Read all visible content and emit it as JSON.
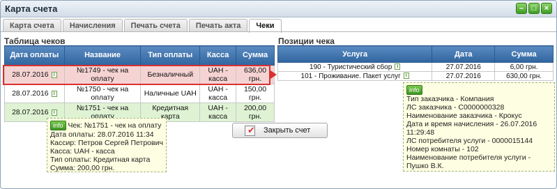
{
  "window": {
    "title": "Карта счета"
  },
  "tabs": [
    {
      "label": "Карта счета"
    },
    {
      "label": "Начисления"
    },
    {
      "label": "Печать счета"
    },
    {
      "label": "Печать акта"
    },
    {
      "label": "Чеки"
    }
  ],
  "checks_table": {
    "title": "Таблица чеков",
    "headers": [
      "Дата оплаты",
      "Название",
      "Тип оплаты",
      "Касса",
      "Сумма"
    ],
    "rows": [
      {
        "date": "28.07.2016",
        "name": "№1749 - чек на оплату",
        "pay_type": "Безналичный",
        "cash_desk": "UAH - касса",
        "sum": "636,00 грн."
      },
      {
        "date": "28.07.2016",
        "name": "№1750 - чек на оплату",
        "pay_type": "Наличные UAH",
        "cash_desk": "UAH - касса",
        "sum": "150,00 грн."
      },
      {
        "date": "28.07.2016",
        "name": "№1751 - чек на оплату",
        "pay_type": "Кредитная карта",
        "cash_desk": "UAH - касса",
        "sum": "200,00 грн."
      }
    ]
  },
  "items_table": {
    "title": "Позиции чека",
    "headers": [
      "Услуга",
      "Дата",
      "Сумма"
    ],
    "rows": [
      {
        "service": "190 - Туристический сбор",
        "date": "27.07.2016",
        "sum": "6,00 грн."
      },
      {
        "service": "101 - Проживание. Пакет услуг",
        "date": "27.07.2016",
        "sum": "630,00 грн."
      }
    ]
  },
  "tip_left": {
    "badge": "info",
    "lines": [
      "Чек: №1751 - чек на оплату",
      "Дата оплаты: 28.07.2016 11:34",
      "Кассир: Петров Сергей Петрович",
      "Касса: UAH - касса",
      "Тип оплаты: Кредитная карта",
      "Сумма: 200,00 грн."
    ]
  },
  "tip_right": {
    "badge": "info",
    "lines": [
      "Тип заказчика - Компания",
      "ЛС заказчика - C0000000328",
      "Наименование заказчика - Крокус",
      "Дата и время начисления - 26.07.2016 11:29:48",
      "ЛС потребителя услуги - 0000015144",
      "Номер комнаты - 102",
      "Наименование потребителя услуги - Пушко В.К."
    ]
  },
  "close_button": {
    "label": "Закрыть счет"
  },
  "info_icon": "i"
}
